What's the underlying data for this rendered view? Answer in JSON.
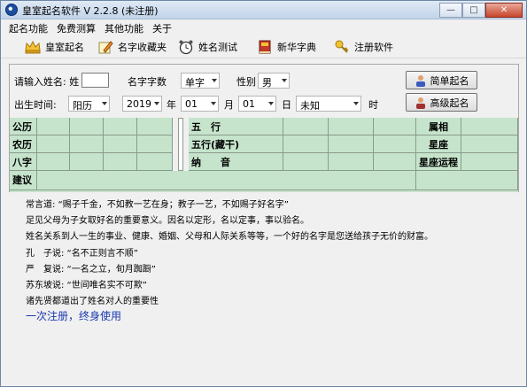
{
  "window": {
    "title": "皇室起名软件 V 2.2.8 (未注册)"
  },
  "menu": [
    "起名功能",
    "免费测算",
    "其他功能",
    "关于"
  ],
  "toolbar": [
    {
      "label": "皇室起名",
      "icon": "crown-icon"
    },
    {
      "label": "名字收藏夹",
      "icon": "pencil-icon"
    },
    {
      "label": "姓名测试",
      "icon": "alarm-clock-icon"
    },
    {
      "label": "新华字典",
      "icon": "book-icon"
    },
    {
      "label": "注册软件",
      "icon": "key-icon"
    }
  ],
  "form": {
    "surname_label": "请输入姓名: 姓",
    "surname_value": "",
    "name_count_label": "名字字数",
    "name_count_value": "单字",
    "gender_label": "性别",
    "gender_value": "男",
    "birth_label": "出生时间:",
    "calendar_value": "阳历",
    "year_value": "2019",
    "year_unit": "年",
    "month_value": "01",
    "month_unit": "月",
    "day_value": "01",
    "day_unit": "日",
    "hour_value": "未知",
    "hour_unit": "时",
    "simple_button": "简单起名",
    "advanced_button": "高级起名"
  },
  "grid": {
    "row1_label": "公历",
    "row2_label": "农历",
    "row3_label": "八字",
    "row4_label": "建议",
    "wuxing_label": "五　行",
    "wuxing_hidden_label": "五行(藏干)",
    "nayin_label": "纳　　音",
    "zodiac_label": "属相",
    "star_label": "星座",
    "star_fortune_label": "星座运程"
  },
  "content": {
    "line1": "常言道: “赐子千金，不如教一艺在身；教子一艺，不如赐子好名字”",
    "line2": "足见父母为子女取好名的重要意义。因名以定形，名以定事，事以验名。",
    "line3": "姓名关系到人一生的事业、健康、婚姻、父母和人际关系等等，一个好的名字是您送给孩子无价的财富。",
    "line4": "孔　子说: “名不正则言不顺”",
    "line5": "严　复说: “一名之立，旬月踟蹰”",
    "line6": "苏东坡说: “世间唯名实不可欺”",
    "line7": "诸先贤都道出了姓名对人的重要性",
    "register": "一次注册，终身使用"
  }
}
